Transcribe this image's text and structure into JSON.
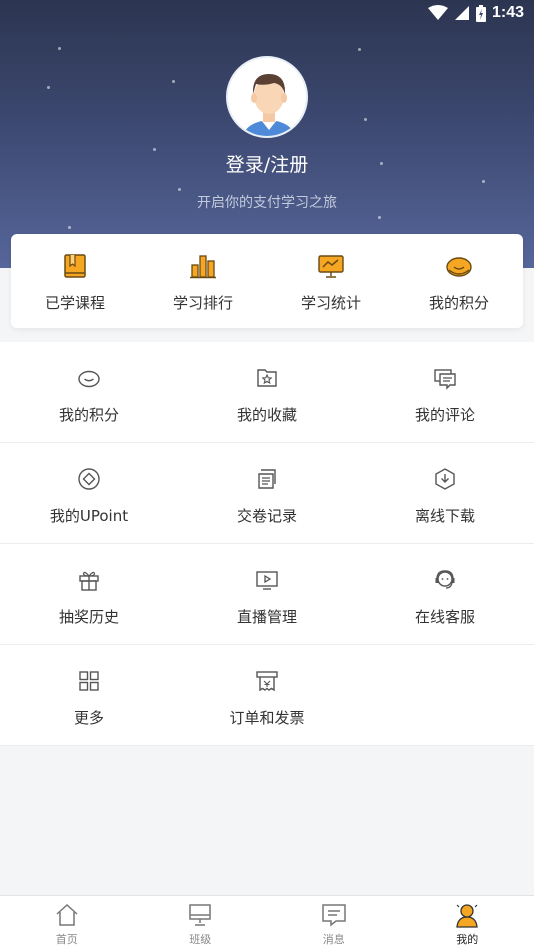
{
  "status_bar": {
    "time": "1:43"
  },
  "profile": {
    "login_label": "登录/注册",
    "subtitle": "开启你的支付学习之旅"
  },
  "quick_actions": [
    {
      "label": "已学课程",
      "icon": "book-icon"
    },
    {
      "label": "学习排行",
      "icon": "ranking-bars-icon"
    },
    {
      "label": "学习统计",
      "icon": "statistics-chart-icon"
    },
    {
      "label": "我的积分",
      "icon": "points-icon"
    }
  ],
  "menu": [
    {
      "label": "我的积分",
      "icon": "points-icon"
    },
    {
      "label": "我的收藏",
      "icon": "favorites-folder-icon"
    },
    {
      "label": "我的评论",
      "icon": "comment-icon"
    },
    {
      "label": "我的UPoint",
      "icon": "upoint-icon"
    },
    {
      "label": "交卷记录",
      "icon": "submission-record-icon"
    },
    {
      "label": "离线下载",
      "icon": "offline-download-icon"
    },
    {
      "label": "抽奖历史",
      "icon": "gift-icon"
    },
    {
      "label": "直播管理",
      "icon": "live-stream-icon"
    },
    {
      "label": "在线客服",
      "icon": "customer-service-icon"
    },
    {
      "label": "更多",
      "icon": "more-grid-icon"
    },
    {
      "label": "订单和发票",
      "icon": "invoice-icon"
    }
  ],
  "tab_bar": [
    {
      "label": "首页",
      "icon": "home-icon"
    },
    {
      "label": "班级",
      "icon": "class-monitor-icon"
    },
    {
      "label": "消息",
      "icon": "message-icon"
    },
    {
      "label": "我的",
      "icon": "profile-icon",
      "active": true
    }
  ],
  "colors": {
    "accent": "#f5a623",
    "header_top": "#2c3550",
    "header_bottom": "#56669a"
  }
}
